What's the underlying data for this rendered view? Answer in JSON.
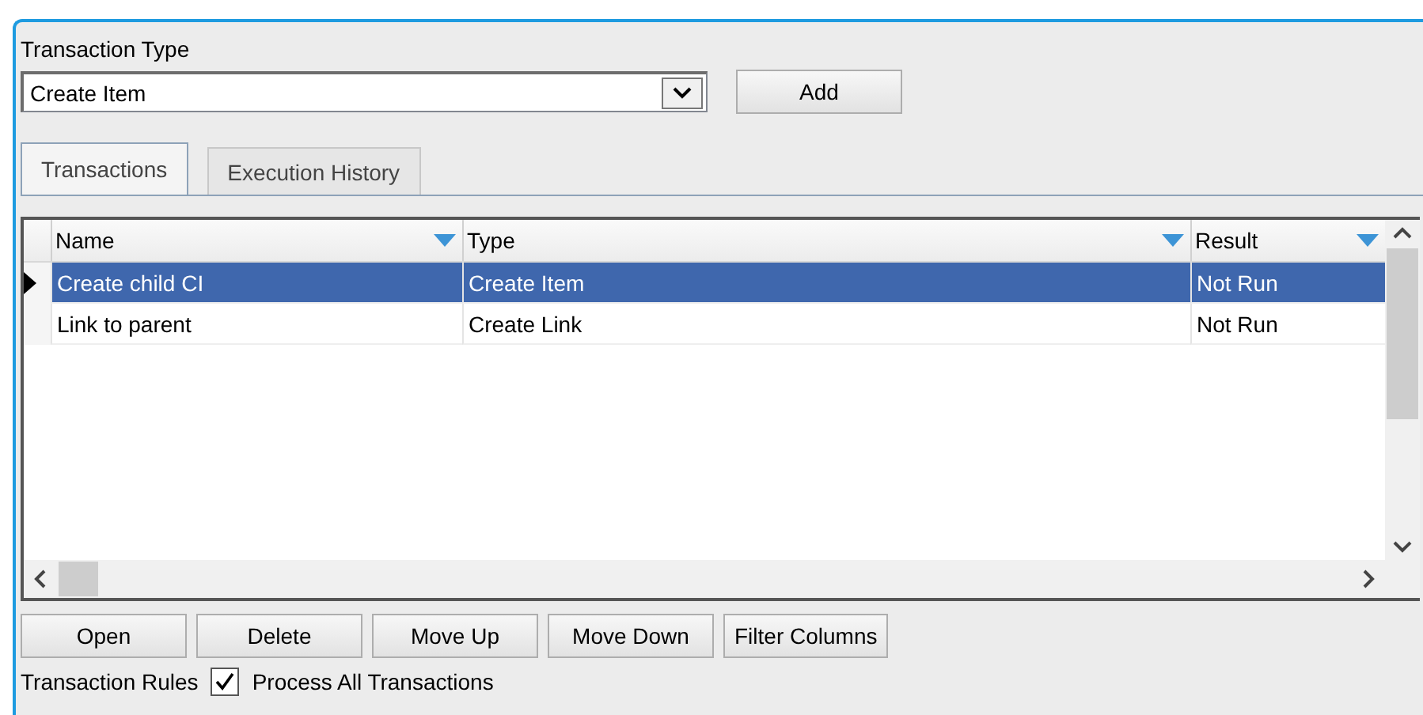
{
  "transaction_type": {
    "label": "Transaction Type",
    "value": "Create Item"
  },
  "add_button": "Add",
  "tabs": [
    {
      "label": "Transactions",
      "selected": true
    },
    {
      "label": "Execution History",
      "selected": false
    }
  ],
  "table": {
    "columns": [
      "Name",
      "Type",
      "Result"
    ],
    "rows": [
      {
        "cells": [
          "Create child CI",
          "Create Item",
          "Not Run"
        ],
        "selected": true
      },
      {
        "cells": [
          "Link to parent",
          "Create Link",
          "Not Run"
        ],
        "selected": false
      }
    ]
  },
  "buttons": [
    "Open",
    "Delete",
    "Move Up",
    "Move Down",
    "Filter Columns"
  ],
  "rules": {
    "label": "Transaction Rules",
    "option": {
      "label": "Process All Transactions",
      "checked": true
    }
  }
}
